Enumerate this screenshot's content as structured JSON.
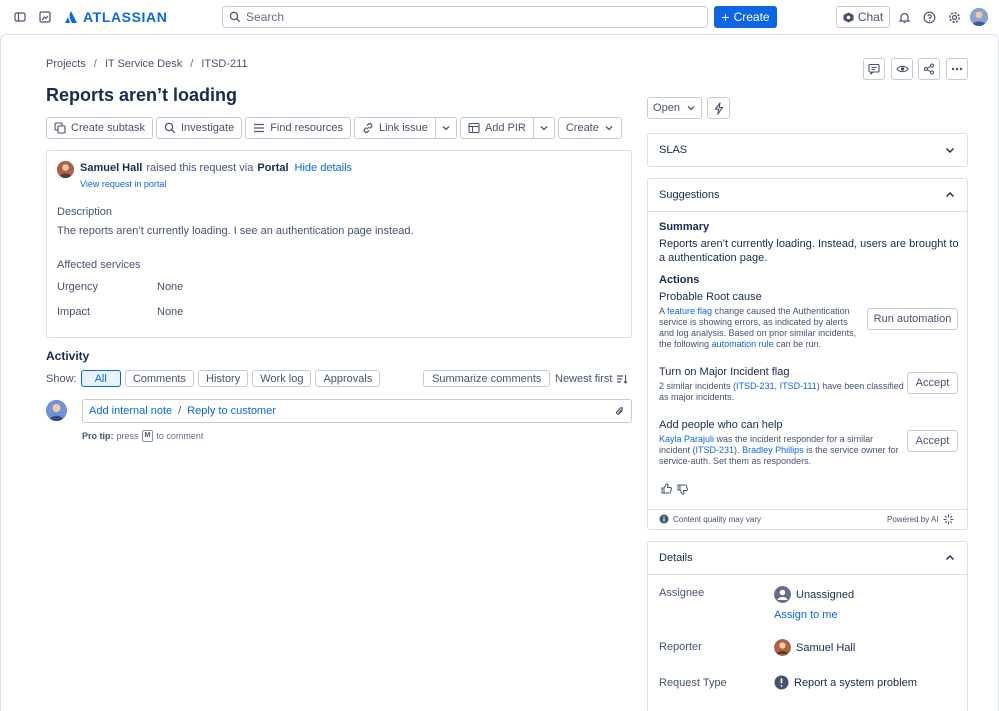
{
  "topbar": {
    "brand": "ATLASSIAN",
    "search_placeholder": "Search",
    "create_label": "Create",
    "chat_label": "Chat",
    "brand_color": "#0c66e4"
  },
  "breadcrumb": {
    "items": [
      "Projects",
      "IT Service Desk",
      "ITSD-211"
    ],
    "separator": "/"
  },
  "issue": {
    "title": "Reports aren’t loading"
  },
  "toolbar": {
    "create_subtask": "Create subtask",
    "investigate": "Investigate",
    "find_resources": "Find resources",
    "link_issue": "Link issue",
    "add_pir": "Add PIR",
    "create": "Create"
  },
  "request": {
    "reporter": "Samuel Hall",
    "raised_text": "raised this request via",
    "channel": "Portal",
    "hide_details": "Hide details",
    "view_portal": "View request in portal",
    "description_label": "Description",
    "description": "The reports aren’t currently loading. I see an authentication page instead.",
    "affected_label": "Affected services",
    "urgency_label": "Urgency",
    "urgency_value": "None",
    "impact_label": "Impact",
    "impact_value": "None"
  },
  "activity": {
    "title": "Activity",
    "show_label": "Show:",
    "filters": [
      "All",
      "Comments",
      "History",
      "Work log",
      "Approvals"
    ],
    "summarize": "Summarize comments",
    "sort": "Newest first",
    "add_note": "Add internal note",
    "separator": "/",
    "reply": "Reply to customer",
    "protip_bold": "Pro tip:",
    "protip_press": "press",
    "protip_key": "M",
    "protip_rest": "to comment"
  },
  "status": {
    "label": "Open"
  },
  "slas": {
    "title": "SLAS"
  },
  "suggestions": {
    "title": "Suggestions",
    "summary_title": "Summary",
    "summary_text": "Reports aren’t currently loading. Instead, users are brought to a authentication page.",
    "actions_title": "Actions",
    "rc_title": "Probable Root cause",
    "rc_a": "A",
    "rc_flag": "feature flag",
    "rc_text1": "change caused the Authentication service is showing errors, as indicated by alerts and log analysis. Based on prior similar incidents, the following",
    "rc_rule": "automation rule",
    "rc_text2": "can be run.",
    "run_automation": "Run automation",
    "mi_title": "Turn on Major Incident flag",
    "mi_text1": "2 similar incidents (",
    "mi_link1": "ITSD-231",
    "mi_comma": ", ",
    "mi_link2": "ITSD-111",
    "mi_text2": ") have been classified as major incidents.",
    "accept_1": "Accept",
    "ap_title": "Add people who can help",
    "ap_person1": "Kayla Parajuli",
    "ap_text1": "was the incident responder for a similar incident (",
    "ap_link": "ITSD-231",
    "ap_text2": ").",
    "ap_person2": "Bradley Phillips",
    "ap_text3": "is the service owner for service-auth. Set them as responders.",
    "accept_2": "Accept",
    "quality": "Content quality may vary",
    "powered": "Powered by AI"
  },
  "details": {
    "title": "Details",
    "assignee_label": "Assignee",
    "assignee_value": "Unassigned",
    "assign_to_me": "Assign to me",
    "reporter_label": "Reporter",
    "reporter_value": "Samuel Hall",
    "request_type_label": "Request Type",
    "request_type_value": "Report a system problem"
  }
}
